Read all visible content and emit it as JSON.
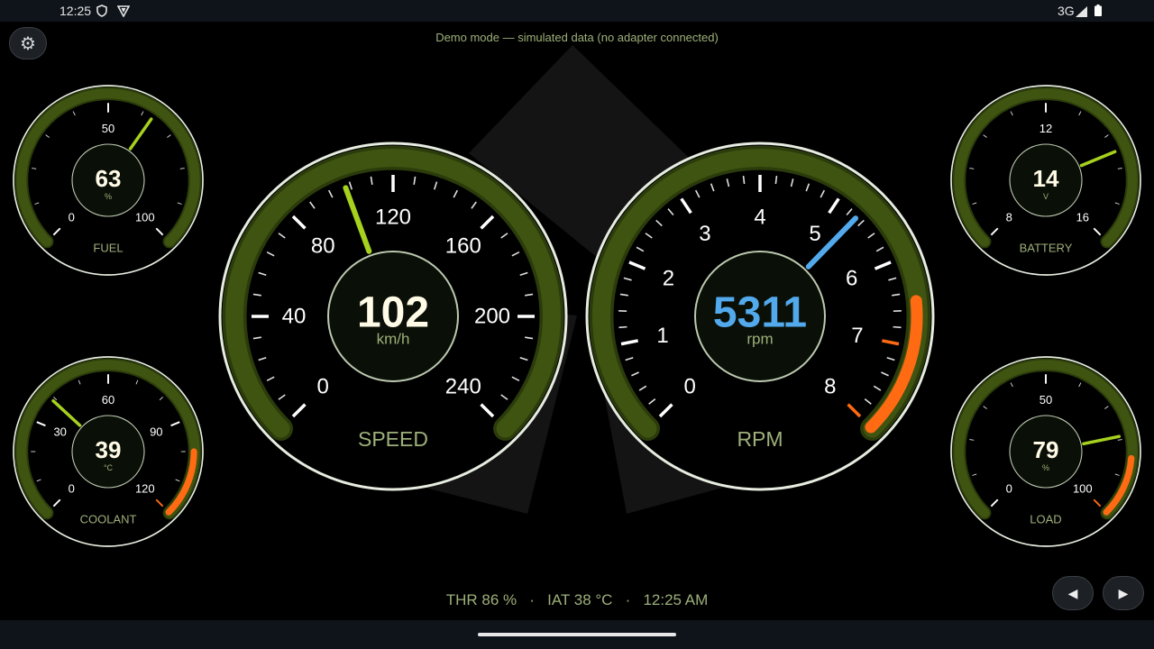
{
  "status_bar": {
    "time": "12:25",
    "network": "3G",
    "icons": [
      "shield-icon",
      "vpn-icon",
      "signal-icon",
      "battery-icon"
    ]
  },
  "app": {
    "demo_banner": "Demo mode — simulated data (no adapter connected)",
    "settings_icon": "gear-icon",
    "footer": {
      "throttle": "THR 86 %",
      "intake_temp": "IAT 38 °C",
      "clock": "12:25 AM",
      "separator": "·"
    },
    "nav": {
      "prev_label": "◀",
      "next_label": "▶"
    }
  },
  "colors": {
    "accent_green": "#a6d11e",
    "arc_green": "#3e5410",
    "label_green": "#9db07a",
    "redline_orange": "#ff6a12",
    "rpm_blue": "#52a9ec",
    "ring": "#e6ede0"
  },
  "gauges": {
    "fuel": {
      "label": "FUEL",
      "value": "63",
      "unit": "%",
      "min": 0,
      "max": 100,
      "reading": 63,
      "labels": [
        "0",
        "50",
        "100"
      ]
    },
    "battery": {
      "label": "BATTERY",
      "value": "14",
      "unit": "V",
      "min": 8,
      "max": 16,
      "reading": 14,
      "labels": [
        "8",
        "12",
        "16"
      ]
    },
    "coolant": {
      "label": "COOLANT",
      "value": "39",
      "unit": "°C",
      "min": 0,
      "max": 120,
      "reading": 39,
      "labels": [
        "0",
        "30",
        "60",
        "90",
        "120"
      ],
      "redline_from": 100
    },
    "load": {
      "label": "LOAD",
      "value": "79",
      "unit": "%",
      "min": 0,
      "max": 100,
      "reading": 79,
      "labels": [
        "0",
        "50",
        "100"
      ],
      "redline_from": 85
    },
    "speed": {
      "label": "SPEED",
      "value": "102",
      "unit": "km/h",
      "min": 0,
      "max": 240,
      "reading": 102,
      "labels": [
        "0",
        "40",
        "80",
        "120",
        "160",
        "200",
        "240"
      ]
    },
    "rpm": {
      "label": "RPM",
      "value": "5311",
      "unit": "rpm",
      "min": 0,
      "max": 8,
      "reading": 5.311,
      "labels": [
        "0",
        "1",
        "2",
        "3",
        "4",
        "5",
        "6",
        "7",
        "8"
      ],
      "redline_from": 6.5
    }
  }
}
